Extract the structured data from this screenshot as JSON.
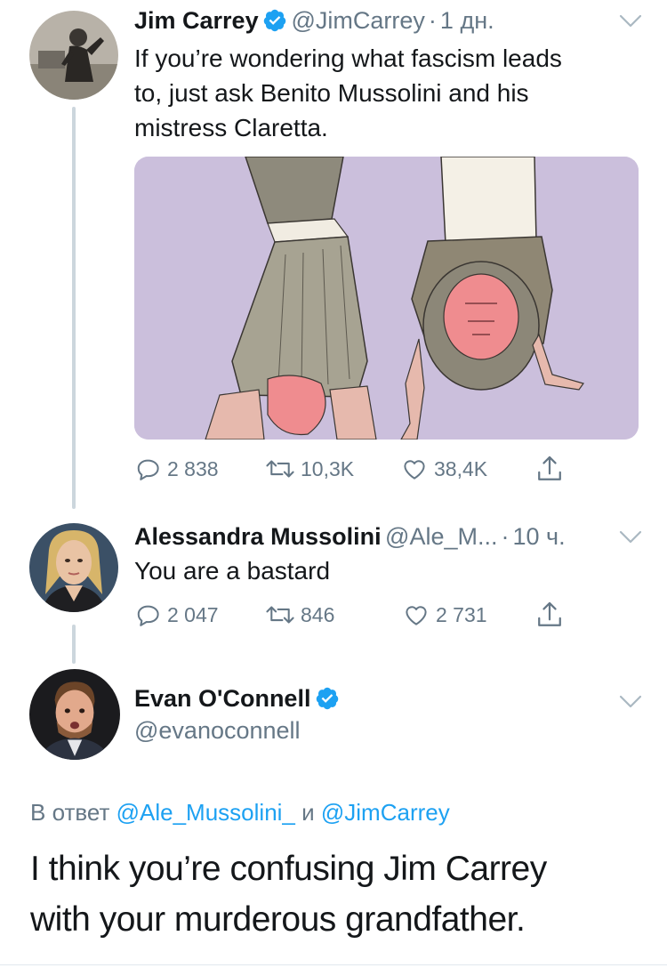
{
  "tweet1": {
    "name": "Jim Carrey",
    "handle": "@JimCarrey",
    "sep": "·",
    "time": "1 дн.",
    "text_lines": [
      "If you’re wondering what fascism leads",
      "to, just ask Benito Mussolini and his",
      "mistress Claretta."
    ],
    "replies": "2 838",
    "retweets": "10,3K",
    "likes": "38,4K"
  },
  "tweet2": {
    "name": "Alessandra Mussolini",
    "handle": "@Ale_M...",
    "sep": "·",
    "time": "10 ч.",
    "text": "You are a bastard",
    "replies": "2 047",
    "retweets": "846",
    "likes": "2 731"
  },
  "tweet3": {
    "name": "Evan O'Connell",
    "handle": "@evanoconnell",
    "reply_prefix": "В ответ",
    "reply_user1": "@Ale_Mussolini_",
    "reply_and": "и",
    "reply_user2": "@JimCarrey",
    "text_lines": [
      "I think you’re confusing Jim Carrey",
      "with your murderous grandfather."
    ]
  },
  "colors": {
    "verified": "#1da1f2",
    "link": "#1da1f2",
    "muted": "#657786",
    "media_bg": "#cfc3df"
  },
  "icons": [
    "reply-icon",
    "retweet-icon",
    "like-icon",
    "share-icon",
    "chevron-down-icon",
    "verified-badge-icon"
  ]
}
